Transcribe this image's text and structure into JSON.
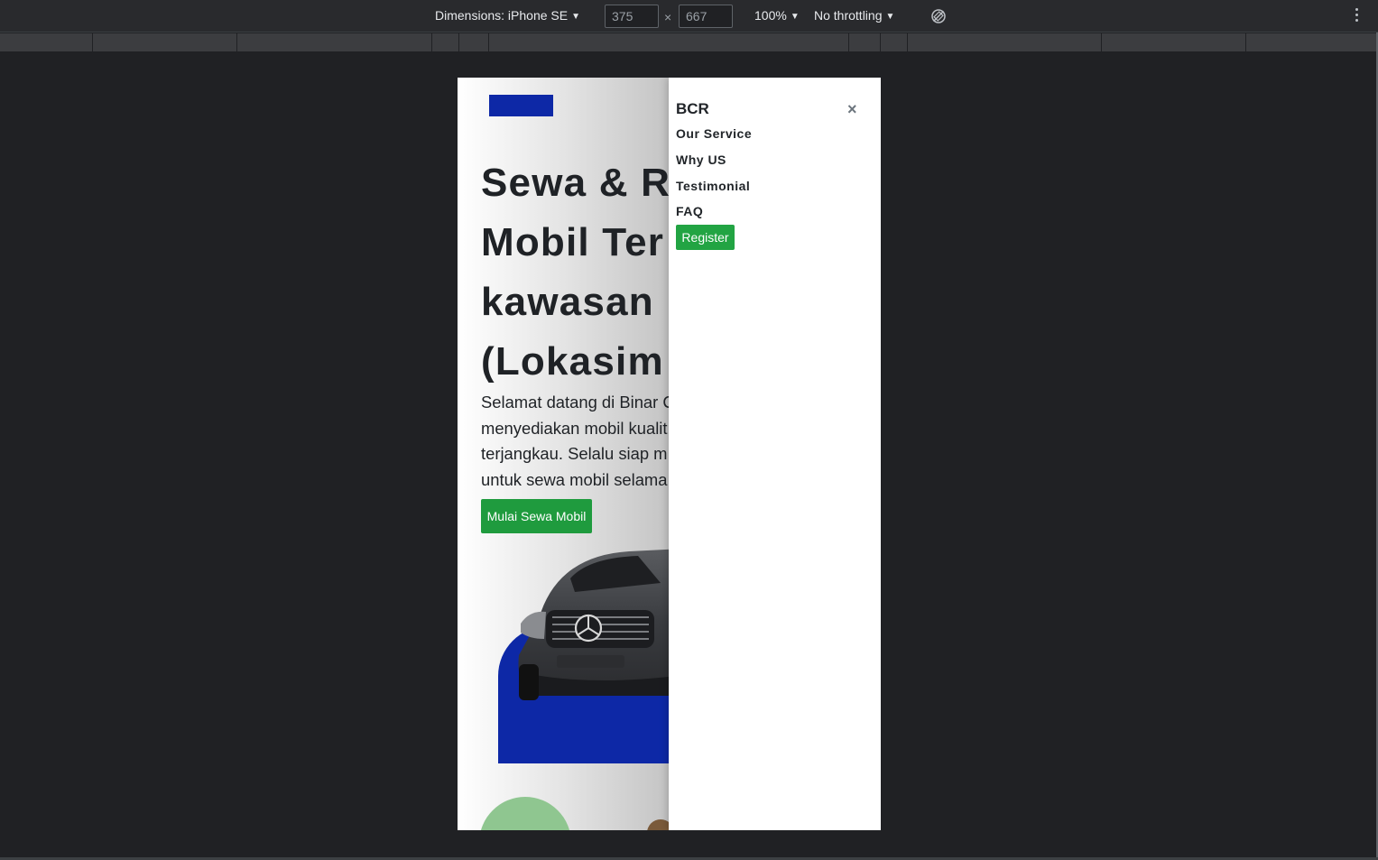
{
  "devtools": {
    "device_label": "Dimensions: iPhone SE",
    "width_value": "375",
    "height_value": "667",
    "times_glyph": "×",
    "zoom_label": "100%",
    "throttle_label": "No throttling"
  },
  "site": {
    "hero": {
      "title_lines": [
        "Sewa & R",
        "Mobil Ter",
        "kawasan",
        "(Lokasim"
      ],
      "description_lines": [
        "Selamat datang di Binar C",
        "menyediakan mobil kualit",
        "terjangkau. Selalu siap m",
        "untuk sewa mobil selama"
      ],
      "cta_label": "Mulai Sewa Mobil"
    },
    "menu": {
      "brand": "BCR",
      "close_glyph": "×",
      "items": [
        "Our Service",
        "Why US",
        "Testimonial",
        "FAQ"
      ],
      "register_label": "Register"
    }
  },
  "colors": {
    "brand_blue": "#0d28a6",
    "cta_green": "#1f9b3e",
    "register_green": "#22a443",
    "devtools_bg": "#202124"
  },
  "icons": [
    "caret-down-icon",
    "rotate-icon",
    "more-vert-icon",
    "close-icon"
  ]
}
